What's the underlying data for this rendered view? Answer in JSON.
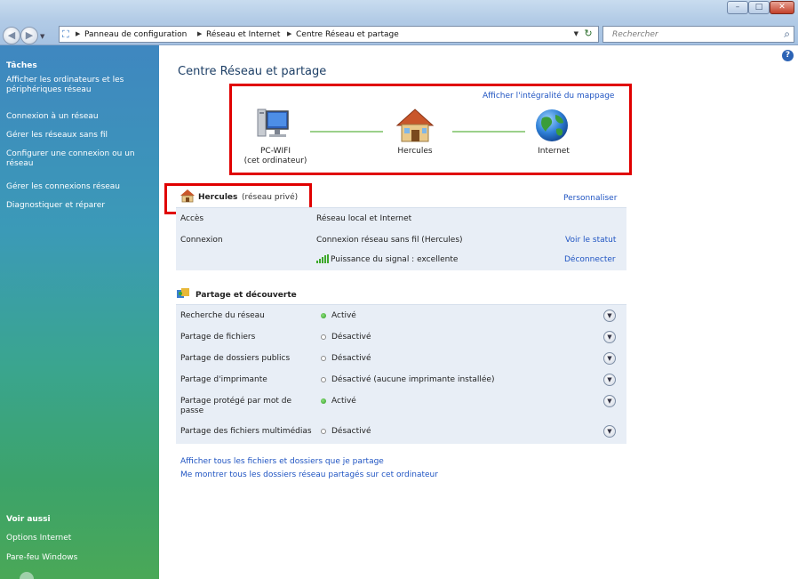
{
  "window": {
    "minimize_glyph": "–",
    "maximize_glyph": "□",
    "close_glyph": "✕"
  },
  "address_bar": {
    "breadcrumbs": [
      "Panneau de configuration",
      "Réseau et Internet",
      "Centre Réseau et partage"
    ],
    "search_placeholder": "Rechercher"
  },
  "sidebar": {
    "tasks_heading": "Tâches",
    "tasks": [
      "Afficher les ordinateurs et les périphériques réseau",
      "Connexion à un réseau",
      "Gérer les réseaux sans fil",
      "Configurer une connexion ou un réseau",
      "Gérer les connexions réseau",
      "Diagnostiquer et réparer"
    ],
    "see_also_heading": "Voir aussi",
    "see_also": [
      "Options Internet",
      "Pare-feu Windows"
    ]
  },
  "main": {
    "title": "Centre Réseau et partage",
    "full_map_link": "Afficher l'intégralité du mappage",
    "map_nodes": [
      {
        "name": "PC-WIFI",
        "sub": "(cet ordinateur)"
      },
      {
        "name": "Hercules",
        "sub": ""
      },
      {
        "name": "Internet",
        "sub": ""
      }
    ],
    "network": {
      "name": "Hercules",
      "type": "(réseau privé)",
      "customize_link": "Personnaliser",
      "rows": [
        {
          "label": "Accès",
          "value": "Réseau local et Internet",
          "link": ""
        },
        {
          "label": "Connexion",
          "value": "Connexion réseau sans fil (Hercules)",
          "link": "Voir le statut"
        },
        {
          "label": "",
          "value": "Puissance du signal : excellente",
          "link": "Déconnecter"
        }
      ]
    },
    "sharing": {
      "title": "Partage et découverte",
      "rows": [
        {
          "label": "Recherche du réseau",
          "status": "Activé",
          "on": true
        },
        {
          "label": "Partage de fichiers",
          "status": "Désactivé",
          "on": false
        },
        {
          "label": "Partage de dossiers publics",
          "status": "Désactivé",
          "on": false
        },
        {
          "label": "Partage d'imprimante",
          "status": "Désactivé (aucune imprimante installée)",
          "on": false
        },
        {
          "label": "Partage protégé par mot de passe",
          "status": "Activé",
          "on": true
        },
        {
          "label": "Partage des fichiers multimédias",
          "status": "Désactivé",
          "on": false
        }
      ]
    },
    "bottom_links": [
      "Afficher tous les fichiers et dossiers que je partage",
      "Me montrer tous les dossiers réseau partagés sur cet ordinateur"
    ]
  }
}
